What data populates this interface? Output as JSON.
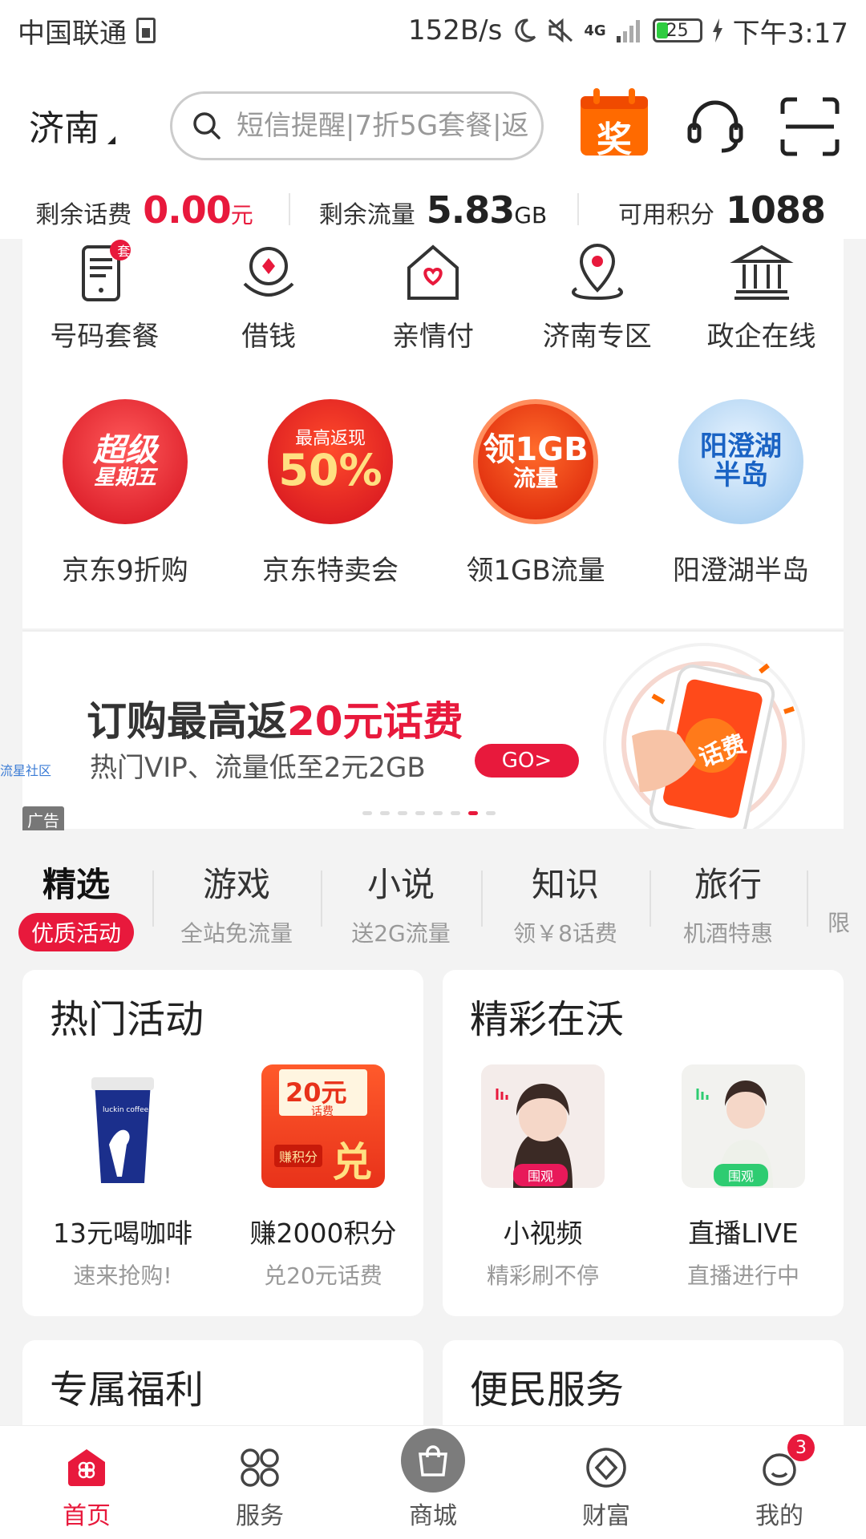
{
  "status_bar": {
    "carrier": "中国联通",
    "speed": "152B/s",
    "network": "4G",
    "battery": "25",
    "time": "下午3:17"
  },
  "header": {
    "city": "济南",
    "search_placeholder": "短信提醒|7折5G套餐|返",
    "prize_label": "奖",
    "icons": [
      "customer-service-icon",
      "scan-icon"
    ]
  },
  "balance": [
    {
      "label": "剩余话费",
      "value": "0.00",
      "unit": "元",
      "color": "#e8193c"
    },
    {
      "label": "剩余流量",
      "value": "5.83",
      "unit": "GB",
      "color": "#222222"
    },
    {
      "label": "可用积分",
      "value": "1088",
      "unit": "",
      "color": "#222222"
    }
  ],
  "quick_services": [
    {
      "label": "号码套餐",
      "badge": "套",
      "icon": "phone-plan-icon"
    },
    {
      "label": "借钱",
      "icon": "loan-icon"
    },
    {
      "label": "亲情付",
      "icon": "family-pay-icon"
    },
    {
      "label": "济南专区",
      "icon": "location-icon"
    },
    {
      "label": "政企在线",
      "icon": "government-icon"
    }
  ],
  "promos": [
    {
      "label": "京东9折购",
      "art": [
        "超级",
        "星期五"
      ]
    },
    {
      "label": "京东特卖会",
      "art": [
        "最高返现",
        "50%"
      ]
    },
    {
      "label": "领1GB流量",
      "art": [
        "领1GB",
        "流量"
      ]
    },
    {
      "label": "阳澄湖半岛",
      "art": [
        "阳澄湖",
        "半岛"
      ]
    }
  ],
  "banner": {
    "title_prefix": "订购最高返",
    "title_highlight": "20元话费",
    "subtitle": "热门VIP、流量低至2元2GB",
    "go_label": "GO>",
    "phone_text": "话费",
    "ad_label": "广告",
    "side_tag": "流星社区",
    "slides": 8,
    "active_slide": 7
  },
  "tabs": [
    {
      "title": "精选",
      "sub": "优质活动",
      "active": true
    },
    {
      "title": "游戏",
      "sub": "全站免流量"
    },
    {
      "title": "小说",
      "sub": "送2G流量"
    },
    {
      "title": "知识",
      "sub": "领￥8话费"
    },
    {
      "title": "旅行",
      "sub": "机酒特惠"
    },
    {
      "title": "",
      "sub": "限"
    }
  ],
  "hot_activities": {
    "title": "热门活动",
    "items": [
      {
        "name": "13元喝咖啡",
        "sub": "速来抢购!",
        "art": "luckin coffee"
      },
      {
        "name": "赚2000积分",
        "sub": "兑20元话费",
        "art": [
          "20元",
          "话费",
          "赚积分",
          "兑"
        ]
      }
    ]
  },
  "wo_highlights": {
    "title": "精彩在沃",
    "items": [
      {
        "name": "小视频",
        "sub": "精彩刷不停",
        "tag": "围观"
      },
      {
        "name": "直播LIVE",
        "sub": "直播进行中",
        "tag": "围观"
      }
    ]
  },
  "more_sections": [
    {
      "title": "专属福利"
    },
    {
      "title": "便民服务"
    }
  ],
  "bottom_nav": [
    {
      "label": "首页",
      "icon": "home-icon",
      "active": true
    },
    {
      "label": "服务",
      "icon": "services-icon"
    },
    {
      "label": "商城",
      "icon": "shopping-bag-icon"
    },
    {
      "label": "财富",
      "icon": "wealth-icon"
    },
    {
      "label": "我的",
      "icon": "profile-icon",
      "badge": "3"
    }
  ],
  "colors": {
    "accent": "#e8193c",
    "accent_orange": "#ff6a00"
  }
}
